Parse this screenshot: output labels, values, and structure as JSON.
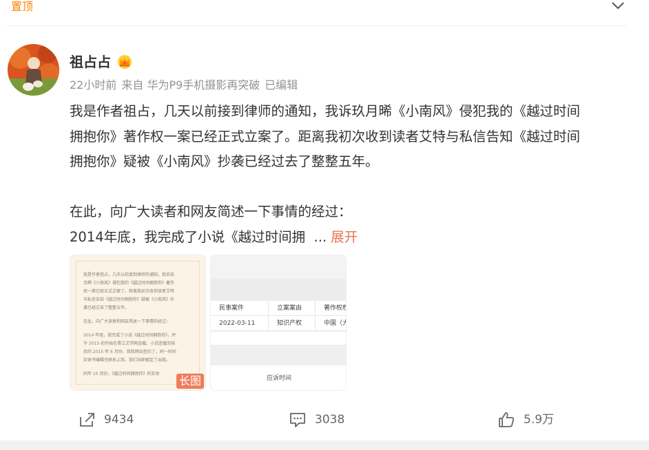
{
  "pinned": {
    "label": "置顶"
  },
  "post": {
    "author": "祖占占",
    "meta": {
      "time": "22小时前",
      "source": "来自 华为P9手机摄影再突破",
      "edited": "已编辑"
    },
    "paragraphs": [
      "我是作者祖占，几天以前接到律师的通知，我诉玖月晞《小南风》侵犯我的《越过时间",
      "拥抱你》著作权一案已经正式立案了。距离我初次收到读者艾特与私信告知《越过时间",
      "拥抱你》疑被《小南风》抄袭已经过去了整整五年。",
      "在此，向广大读者和网友简述一下事情的经过：",
      "2014年底，我完成了小说《越过时间拥"
    ],
    "ellipsis": "...",
    "expand_label": "展开",
    "images": {
      "doc_lines": [
        "我是作者祖占，几天以前接到律师的通知，我诉玖",
        "月晞《小南风》侵犯我的《越过时间拥抱你》著作",
        "权一案已经正式立案了。距离我初次收到读者艾特",
        "与私信告知《越过时间拥抱你》疑被《小南风》抄",
        "袭已经过去了整整五年。",
        "在此，向广大读者和网友简述一下事情的经过：",
        "2014 年底，我完成了小说《越过时间拥抱你》，并",
        "于 2015 初开始在晋江文学网连载。小说连载完结",
        "后的 2015 年 6 月份，我和网站签约了，同一时间",
        "实体书编辑也联系上我，我们当即敲定了出版。",
        "同年 10 月份，《越过时间拥抱你》的实体"
      ],
      "long_badge": "长图",
      "table_header": [
        "民事案件",
        "立案案由",
        "著作权权"
      ],
      "table_row": [
        "2022-03-11",
        "知识产权",
        "中国（大"
      ],
      "table_footer": "应诉时间"
    }
  },
  "actions": {
    "share_count": "9434",
    "comment_count": "3038",
    "like_count": "5.9万"
  },
  "colors": {
    "accent": "#ff8200",
    "expand": "#eb7350",
    "meta_gray": "#939393"
  }
}
